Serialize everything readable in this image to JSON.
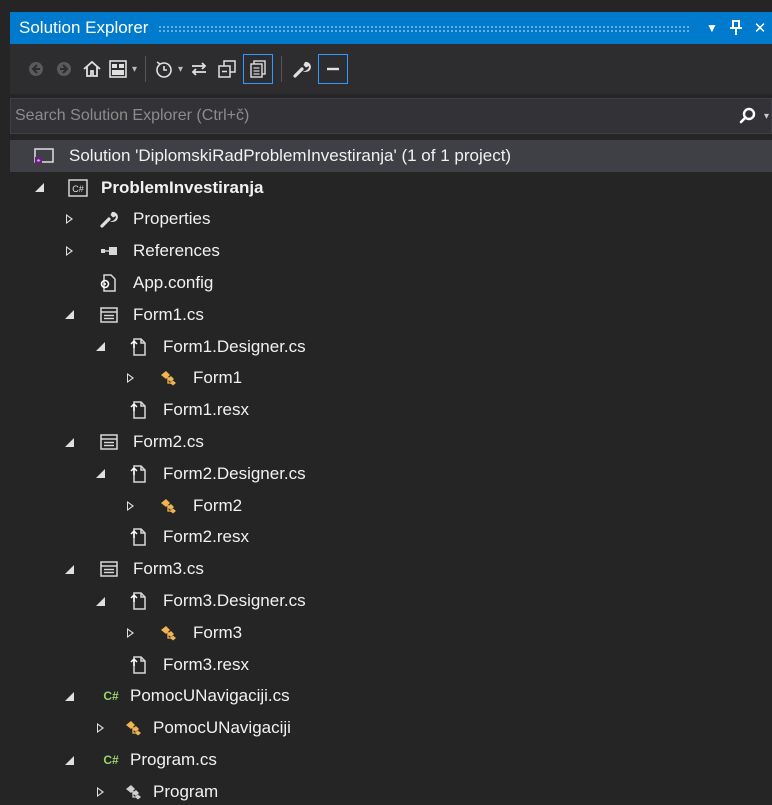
{
  "panel": {
    "title": "Solution Explorer",
    "dropdown_glyph": "▼",
    "pin_glyph": "Ꮇ",
    "close_glyph": "✕"
  },
  "toolbar": {
    "icons": [
      "back-icon",
      "forward-icon",
      "home-icon",
      "switch-views-icon",
      "pending-changes-filter-icon",
      "sync-with-active-document-icon",
      "collapse-all-icon",
      "show-all-files-icon",
      "properties-icon",
      "preview-selected-items-icon"
    ]
  },
  "search": {
    "placeholder": "Search Solution Explorer (Ctrl+č)"
  },
  "tree": {
    "solution": {
      "label": "Solution 'DiplomskiRadProblemInvestiranja' (1 of 1 project)"
    },
    "project": {
      "label": "ProblemInvestiranja",
      "badge": "C#"
    },
    "properties": {
      "label": "Properties"
    },
    "references": {
      "label": "References"
    },
    "app_config": {
      "label": "App.config"
    },
    "form1": {
      "label": "Form1.cs"
    },
    "form1_designer": {
      "label": "Form1.Designer.cs"
    },
    "form1_class": {
      "label": "Form1"
    },
    "form1_resx": {
      "label": "Form1.resx"
    },
    "form2": {
      "label": "Form2.cs"
    },
    "form2_designer": {
      "label": "Form2.Designer.cs"
    },
    "form2_class": {
      "label": "Form2"
    },
    "form2_resx": {
      "label": "Form2.resx"
    },
    "form3": {
      "label": "Form3.cs"
    },
    "form3_designer": {
      "label": "Form3.Designer.cs"
    },
    "form3_class": {
      "label": "Form3"
    },
    "form3_resx": {
      "label": "Form3.resx"
    },
    "pomoc": {
      "label": "PomocUNavigaciji.cs",
      "badge": "C#"
    },
    "pomoc_class": {
      "label": "PomocUNavigaciji"
    },
    "program": {
      "label": "Program.cs",
      "badge": "C#"
    },
    "program_class": {
      "label": "Program"
    }
  },
  "colors": {
    "accent": "#007acc",
    "background": "#252526",
    "selected_row": "#3f3f46",
    "class_icon": "#f0b450",
    "csharp_badge": "#9bd36b"
  }
}
